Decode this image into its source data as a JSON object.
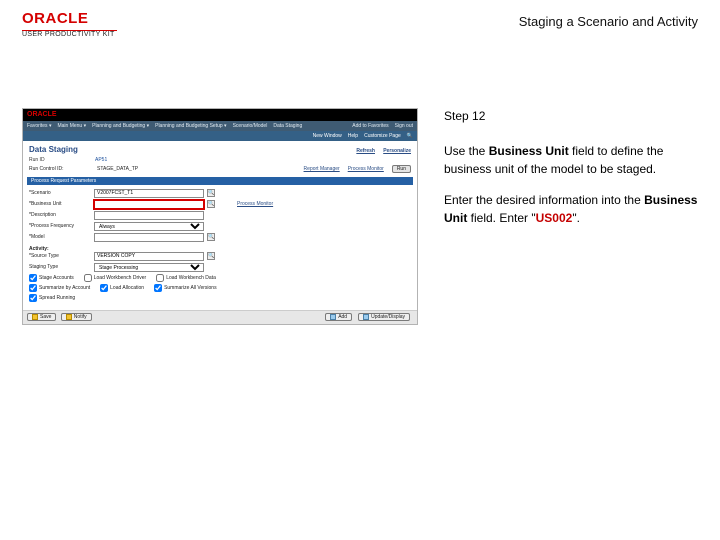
{
  "header": {
    "brand_main": "ORACLE",
    "brand_sub": "USER PRODUCTIVITY KIT",
    "title": "Staging a Scenario and Activity"
  },
  "instructions": {
    "step_label": "Step 12",
    "p1_pre": "Use the ",
    "p1_bold": "Business Unit",
    "p1_post": " field to define the business unit of the model to be staged.",
    "p2_pre": "Enter the desired information into the ",
    "p2_bold": "Business Unit",
    "p2_mid": " field. Enter \"",
    "p2_val": "US002",
    "p2_end": "\"."
  },
  "screenshot": {
    "topbar": {
      "oracle": "ORACLE",
      "right_text": ""
    },
    "nav": {
      "items": [
        "Favorites ▾",
        "Main Menu ▾",
        "Planning and Budgeting ▾",
        "Planning and Budgeting Setup ▾",
        "Scenario/Model",
        "Data Staging"
      ],
      "right": [
        "Add to Favorites",
        "Sign out"
      ]
    },
    "subnav": {
      "right": [
        "New Window",
        "Help",
        "Customize Page",
        "🔍"
      ]
    },
    "page_title": "Data Staging",
    "links": {
      "refresh": "Refresh",
      "prefs": "Personalize"
    },
    "id_row": {
      "label": "Run ID",
      "value": "AP51"
    },
    "run_row": {
      "label": "Run Control ID:",
      "value": "STAGE_DATA_TP",
      "report_link": "Report Manager",
      "pm_link": "Process Monitor",
      "run_btn": "Run"
    },
    "section": "Process Request Parameters",
    "fields": {
      "scenario": {
        "label": "Scenario",
        "value": "V2007FCST_T1"
      },
      "bu": {
        "label": "Business Unit",
        "value": ""
      },
      "desc": {
        "label": "Description",
        "value": ""
      },
      "pf": {
        "label": "Process Frequency",
        "value": "Always"
      },
      "model": {
        "label": "Model",
        "value": ""
      },
      "pm_link": "Process Monitor"
    },
    "activity_heading": "Activity:",
    "activity": {
      "source_type": {
        "label": "Source Type",
        "value": "VERSION COPY"
      },
      "staging_type": {
        "label": "Staging Type",
        "value": "Stage Processing"
      }
    },
    "checks": {
      "row1": [
        {
          "label": "Stage Accounts",
          "checked": true
        },
        {
          "label": "Load Workbench Driver",
          "checked": false
        },
        {
          "label": "Load Workbench Data",
          "checked": false
        }
      ],
      "row2": [
        {
          "label": "Summarize by Account",
          "checked": true
        },
        {
          "label": "Load Allocation",
          "checked": true
        },
        {
          "label": "Summarize All Versions",
          "checked": true
        }
      ],
      "row3": [
        {
          "label": "Spread Running",
          "checked": true
        }
      ]
    },
    "bottom": {
      "save": "Save",
      "notify": "Notify",
      "add": "Add",
      "update": "Update/Display"
    }
  }
}
